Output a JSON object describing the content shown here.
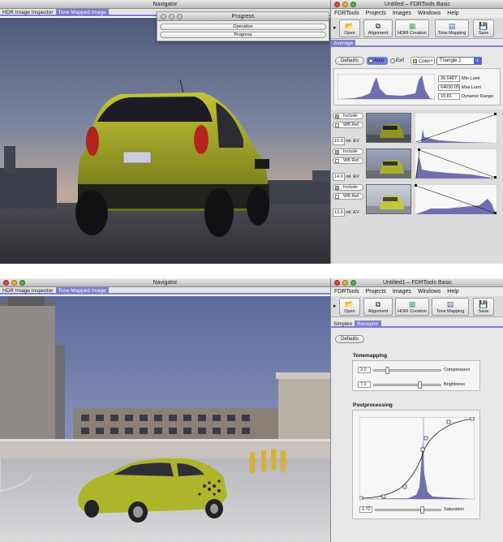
{
  "top": {
    "navigator": {
      "title": "Navigator",
      "tabs": [
        {
          "label": "HDR Image Inspector",
          "active": false
        },
        {
          "label": "Tone Mapped Image",
          "active": true
        }
      ]
    },
    "progress": {
      "title": "Progress",
      "rows": [
        "Operation",
        "Progress"
      ]
    },
    "fdr": {
      "title": "Untitled – FDRTools Basic",
      "menu": [
        "FDRTools",
        "Projects",
        "Images",
        "Windows",
        "Help"
      ],
      "toolbar": [
        "Open",
        "Alignment",
        "HDRI Creation",
        "Tone Mapping",
        "Save"
      ],
      "subtab": "Average",
      "defaults_label": "Defaults",
      "radio_auto": "Auto",
      "radio_exif": "Exif",
      "color_label": "Color+",
      "dropdown_value": "Triangle 2",
      "stats": [
        {
          "value": "36.0487",
          "label": "Min Lumi"
        },
        {
          "value": "64630.05",
          "label": "Max Lumi"
        },
        {
          "value": "10.81",
          "label": "Dynamic Range"
        }
      ],
      "include_label": "Include",
      "wbref_label": "WB Ref.",
      "images": [
        {
          "ev": "15.9",
          "ev_unit": "rel. EV"
        },
        {
          "ev": "14.9",
          "ev_unit": "rel. EV"
        },
        {
          "ev": "13.9",
          "ev_unit": "rel. EV"
        }
      ]
    }
  },
  "bottom": {
    "navigator": {
      "title": "Navigator",
      "tabs": [
        {
          "label": "HDR Image Inspector",
          "active": false
        },
        {
          "label": "Tone Mapped Image",
          "active": true
        }
      ]
    },
    "fdr": {
      "title": "Untitled1 – FDRTools Basic",
      "menu": [
        "FDRTools",
        "Projects",
        "Images",
        "Windows",
        "Help"
      ],
      "toolbar": [
        "Open",
        "Alignment",
        "HDRI Creation",
        "Tone Mapping",
        "Save"
      ],
      "subtabs": [
        {
          "label": "Simplex",
          "active": false
        },
        {
          "label": "Receptor",
          "active": true
        }
      ],
      "defaults_label": "Defaults",
      "tonemapping": {
        "title": "Tonemapping",
        "compression": {
          "value": "2.0",
          "label": "Compression",
          "level": 0.18
        },
        "brightness": {
          "value": "7.0",
          "label": "Brightness",
          "level": 0.7
        }
      },
      "postprocessing": {
        "title": "Postprocessing",
        "saturation": {
          "value": "1.72",
          "label": "Saturation",
          "level": 0.73
        }
      }
    }
  },
  "colors": {
    "accent": "#7b7fd1",
    "car": "#b4bc2a"
  }
}
